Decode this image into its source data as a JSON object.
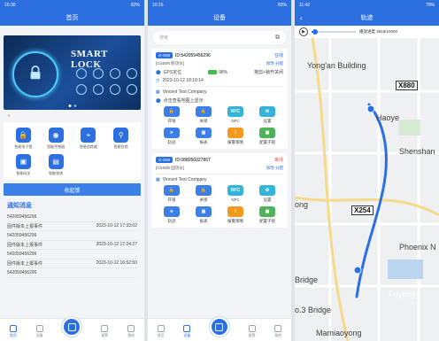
{
  "screen1": {
    "status_time": "10:30",
    "status_right": "82%",
    "title": "首页",
    "banner_title": "SMART LOCK",
    "notice_icon": "speaker-icon",
    "features": [
      {
        "label": "智能电子锁",
        "icon": "lock-icon"
      },
      {
        "label": "智能传感器",
        "icon": "sensor-icon"
      },
      {
        "label": "智能追踪器",
        "icon": "tracker-icon"
      },
      {
        "label": "智能挂锁",
        "icon": "padlock-icon"
      },
      {
        "label": "智能网关",
        "icon": "gateway-icon"
      },
      {
        "label": "智能锁袋",
        "icon": "bag-icon"
      }
    ],
    "bluebar": "收起锁",
    "notif_header": "通知消息",
    "notifications": [
      {
        "id": "542059456296",
        "event": "",
        "time": ""
      },
      {
        "id": "",
        "event": "固件版本上报事件",
        "time": "2023-10-12 17:33:02"
      },
      {
        "id": "542059456296",
        "event": "",
        "time": ""
      },
      {
        "id": "",
        "event": "固件版本上报事件",
        "time": "2023-10-12 17:24:27"
      },
      {
        "id": "542059456296",
        "event": "",
        "time": ""
      },
      {
        "id": "",
        "event": "固件版本上报事件",
        "time": "2023-10-12 16:52:50"
      },
      {
        "id": "542059456296",
        "event": "",
        "time": ""
      }
    ],
    "tabs": [
      "首页",
      "设备",
      "",
      "报警",
      "我的"
    ]
  },
  "screen2": {
    "status_time": "10:16",
    "status_right": "83%",
    "title": "设备",
    "search_placeholder": "搜索",
    "cards": [
      {
        "badge": "G-S08",
        "device_id": "ID:542059456296",
        "status": "在线",
        "model": "[GS08N 耐功仪]",
        "links": "修改 分配",
        "location": "GPS定位",
        "battery": "98%",
        "lock_state": "拖剪+锁开关闭",
        "time": "2023-10-12 18:18:14",
        "company": "Vincent Test Company",
        "map_hint": "点击查看地图上显示",
        "actions": [
          {
            "label": "开锁",
            "icon": "lock-open-icon",
            "color": "#3d7fe8"
          },
          {
            "label": "关锁",
            "icon": "lock-icon",
            "color": "#3d7fe8"
          },
          {
            "label": "NFC",
            "icon": "nfc-icon",
            "color": "#33b4d8"
          },
          {
            "label": "设置",
            "icon": "settings-icon",
            "color": "#33b4d8"
          },
          {
            "label": "轨迹",
            "icon": "track-icon",
            "color": "#3d7fe8"
          },
          {
            "label": "报表",
            "icon": "report-icon",
            "color": "#3d7fe8"
          },
          {
            "label": "报警策略",
            "icon": "alarm-icon",
            "color": "#f39a1e"
          },
          {
            "label": "配置子锁",
            "icon": "sublock-icon",
            "color": "#4fb35c"
          }
        ]
      },
      {
        "badge": "G-S08",
        "device_id": "ID:088056027867",
        "status": "离线",
        "model": "[GS08N 固功仪]",
        "links": "修改 分配",
        "company": "Vincent Test Company",
        "actions": [
          {
            "label": "开锁",
            "icon": "lock-open-icon",
            "color": "#3d7fe8"
          },
          {
            "label": "关锁",
            "icon": "lock-icon",
            "color": "#3d7fe8"
          },
          {
            "label": "NFC",
            "icon": "nfc-icon",
            "color": "#33b4d8"
          },
          {
            "label": "设置",
            "icon": "settings-icon",
            "color": "#33b4d8"
          },
          {
            "label": "轨迹",
            "icon": "track-icon",
            "color": "#3d7fe8"
          },
          {
            "label": "报表",
            "icon": "report-icon",
            "color": "#3d7fe8"
          },
          {
            "label": "报警策略",
            "icon": "alarm-icon",
            "color": "#f39a1e"
          },
          {
            "label": "配置子锁",
            "icon": "sublock-icon",
            "color": "#4fb35c"
          }
        ]
      }
    ],
    "tabs": [
      "首页",
      "设备",
      "",
      "报警",
      "我的"
    ]
  },
  "screen3": {
    "status_time": "11:42",
    "status_right": "79%",
    "title": "轨迹",
    "progress_label": "播放进度 2816/10000",
    "map_labels": [
      "Yong'an Building",
      "Haoye",
      "Shenshan",
      "X880",
      "X254",
      "Phoenix N",
      "Bridge",
      "Fuyong",
      "o.3 Bridge",
      "Mamiaoyong",
      "ong"
    ]
  },
  "colors": {
    "primary": "#2c6fe0",
    "warning": "#e98b2a",
    "offline": "#e05050"
  }
}
